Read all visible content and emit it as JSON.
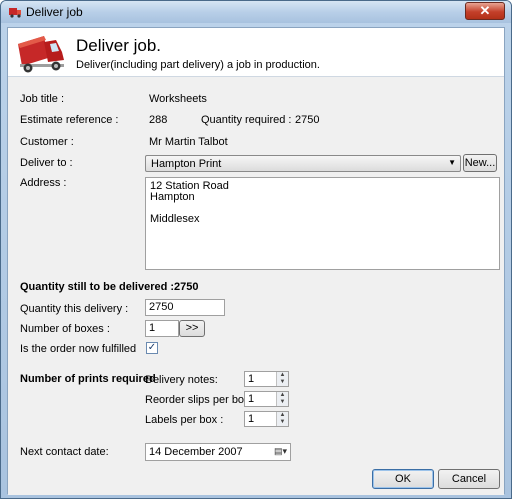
{
  "window": {
    "title": "Deliver job",
    "close_glyph": "✕"
  },
  "header": {
    "title": "Deliver job.",
    "subtitle": "Deliver(including part delivery) a job in production.",
    "icon": "delivery-truck-icon"
  },
  "job": {
    "job_title_label": "Job title :",
    "job_title_value": "Worksheets",
    "estimate_label": "Estimate reference :",
    "estimate_value": "288",
    "quantity_required_label": "Quantity required :",
    "quantity_required_value": "2750",
    "customer_label": "Customer :",
    "customer_value": "Mr Martin Talbot",
    "deliver_to_label": "Deliver to :",
    "deliver_to_value": "Hampton Print",
    "new_button": "New...",
    "address_label": "Address :",
    "address_lines": [
      "12 Station Road",
      "Hampton",
      "",
      "Middlesex"
    ]
  },
  "delivery": {
    "remaining_label": "Quantity still to be delivered :2750",
    "quantity_label": "Quantity this delivery :",
    "quantity_value": "2750",
    "boxes_label": "Number of boxes :",
    "boxes_value": "1",
    "boxes_button": ">>",
    "fulfilled_label": "Is the order now  fulfilled",
    "fulfilled_checked": true,
    "check_glyph": "✓"
  },
  "prints": {
    "section_label": "Number of prints required",
    "delivery_notes_label": "Delivery notes:",
    "delivery_notes_value": "1",
    "reorder_label": "Reorder slips per box :",
    "reorder_value": "1",
    "labels_label": "Labels per box :",
    "labels_value": "1"
  },
  "contact": {
    "label": "Next contact date:",
    "value": "14 December 2007"
  },
  "buttons": {
    "ok": "OK",
    "cancel": "Cancel"
  },
  "colors": {
    "accent": "#3b6ea5",
    "truck": "#c62828"
  }
}
